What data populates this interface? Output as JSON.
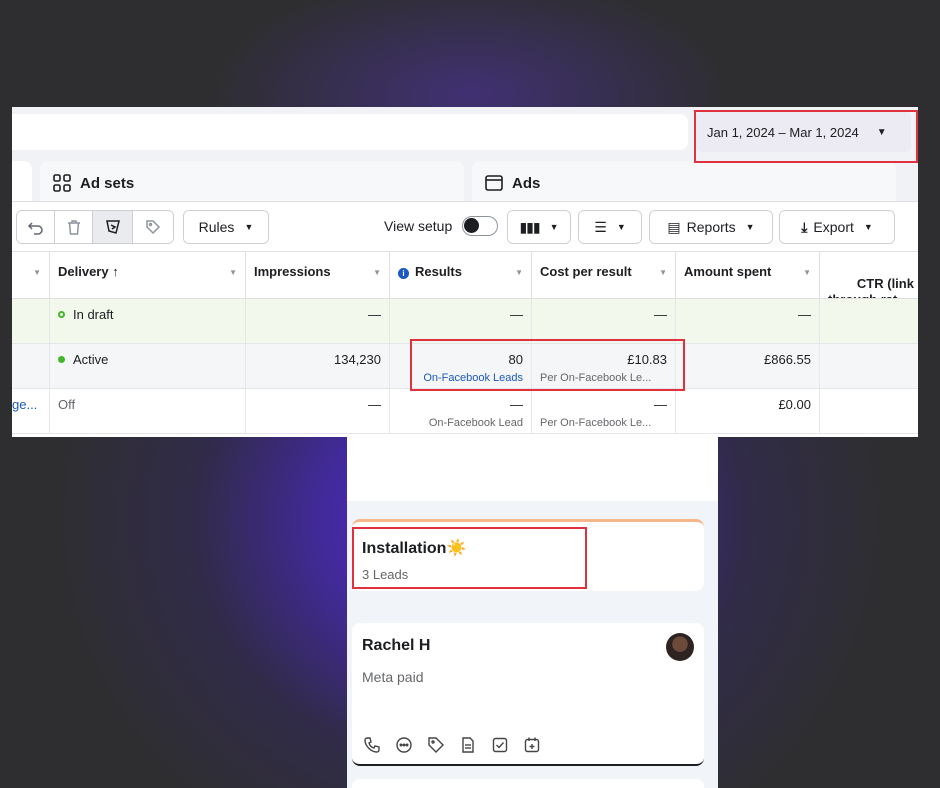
{
  "ads_manager": {
    "date_range": "Jan 1, 2024 – Mar 1, 2024",
    "tabs": [
      {
        "label": "Ad sets",
        "icon": "ad-sets-icon"
      },
      {
        "label": "Ads",
        "icon": "ads-icon"
      }
    ],
    "toolbar": {
      "rules_label": "Rules",
      "view_setup_label": "View setup",
      "reports_label": "Reports",
      "export_label": "Export"
    },
    "columns": [
      "Delivery ↑",
      "Impressions",
      "Results",
      "Cost per result",
      "Amount spent",
      "CTR (link cl\nthrough rat"
    ],
    "rows": [
      {
        "name": "",
        "delivery": "In draft",
        "status": "draft",
        "impressions": "—",
        "results": "—",
        "results_sub": "",
        "cost": "—",
        "cost_sub": "",
        "spent": "—"
      },
      {
        "name": "",
        "delivery": "Active",
        "status": "active",
        "impressions": "134,230",
        "results": "80",
        "results_sub": "On-Facebook Leads",
        "cost": "£10.83",
        "cost_sub": "Per On-Facebook Le...",
        "spent": "£866.55"
      },
      {
        "name": "ge...",
        "delivery": "Off",
        "status": "off",
        "impressions": "—",
        "results": "—",
        "results_sub": "On-Facebook Lead",
        "cost": "—",
        "cost_sub": "Per On-Facebook Le...",
        "spent": "£0.00"
      }
    ]
  },
  "crm": {
    "stage": {
      "title": "Installation☀️",
      "subtitle": "3 Leads"
    },
    "lead": {
      "name": "Rachel H",
      "source": "Meta paid"
    },
    "lead_actions": [
      "phone-icon",
      "chat-icon",
      "tag-icon",
      "note-icon",
      "task-icon",
      "calendar-icon"
    ]
  },
  "colors": {
    "highlight": "#e0323e",
    "active_green": "#42b72a",
    "link_blue": "#1b58c4"
  }
}
